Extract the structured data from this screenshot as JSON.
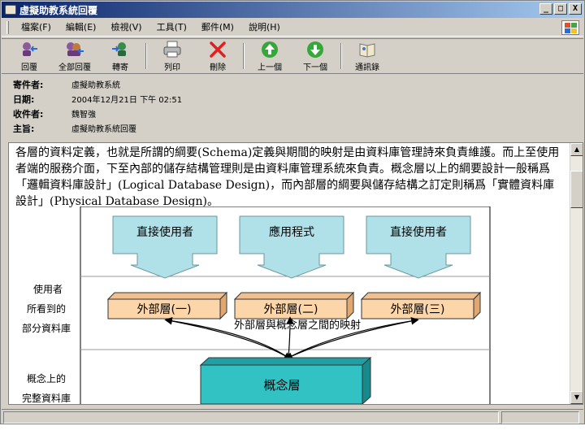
{
  "window": {
    "title": "虛擬助教系統回覆",
    "buttons": {
      "minimize": "_",
      "maximize": "□",
      "close": "X"
    }
  },
  "menu": [
    {
      "label": "檔案(F)"
    },
    {
      "label": "編輯(E)"
    },
    {
      "label": "檢視(V)"
    },
    {
      "label": "工具(T)"
    },
    {
      "label": "郵件(M)"
    },
    {
      "label": "說明(H)"
    }
  ],
  "toolbar": [
    {
      "label": "回覆",
      "icon": "reply-icon"
    },
    {
      "label": "全部回覆",
      "icon": "reply-all-icon"
    },
    {
      "label": "轉寄",
      "icon": "forward-icon"
    },
    {
      "label": "列印",
      "icon": "print-icon"
    },
    {
      "label": "刪除",
      "icon": "delete-icon"
    },
    {
      "label": "上一個",
      "icon": "arrow-up-icon"
    },
    {
      "label": "下一個",
      "icon": "arrow-down-icon"
    },
    {
      "label": "通訊錄",
      "icon": "address-book-icon"
    }
  ],
  "headers": {
    "from": {
      "label": "寄件者:",
      "value": "虛擬助教系統"
    },
    "date": {
      "label": "日期:",
      "value": "2004年12月21日 下午 02:51"
    },
    "to": {
      "label": "收件者:",
      "value": "魏智強"
    },
    "subject": {
      "label": "主旨:",
      "value": "虛擬助教系統回覆"
    }
  },
  "body": {
    "paragraph": "各層的資料定義，也就是所謂的綱要(Schema)定義與期間的映射是由資料庫管理詩來負責維護。而上至使用者端的服務介面，下至內部的儲存結構管理則是由資料庫管理系統來負責。概念層以上的綱要設計一般稱爲「邏輯資料庫設計」(Logical Database Design)，而內部層的綱要與儲存結構之訂定則稱爲「實體資料庫設計」(Physical Database Design)。"
  },
  "diagram": {
    "top_boxes": [
      "直接使用者",
      "應用程式",
      "直接使用者"
    ],
    "external_layers": [
      "外部層(一)",
      "外部層(二)",
      "外部層(三)"
    ],
    "mapping_label": "外部層與概念層之間的映射",
    "concept_layer": "概念層",
    "side_labels": [
      "使用者",
      "所看到的",
      "部分資料庫",
      "概念上的",
      "完整資料庫"
    ],
    "colors": {
      "top_box": "#b0e0e8",
      "external": "#fcd5a8",
      "concept": "#33c2c4"
    }
  }
}
